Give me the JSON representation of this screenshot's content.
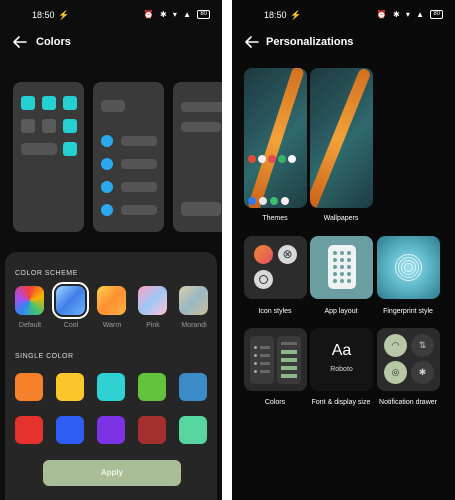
{
  "status": {
    "time": "18:50",
    "battery": "80"
  },
  "left": {
    "title": "Colors",
    "color_scheme_label": "COLOR SCHEME",
    "schemes": [
      {
        "name": "Default",
        "gradient": "conic-gradient(#f1413a,#f8b400,#43c76d,#2f86f6,#b24ae6,#f1413a)"
      },
      {
        "name": "Cool",
        "gradient": "linear-gradient(135deg,#9fd6ff,#3f7fe8,#6fb4ff)"
      },
      {
        "name": "Warm",
        "gradient": "linear-gradient(135deg,#ffd14f,#ff8f2f,#ffb347)"
      },
      {
        "name": "Pink",
        "gradient": "linear-gradient(135deg,#ff9fc0,#9fc7f5,#ffc3d5)"
      },
      {
        "name": "Morandi",
        "gradient": "linear-gradient(135deg,#d6d0a8,#9ab8c4,#c9bf96)"
      }
    ],
    "single_color_label": "SINGLE COLOR",
    "single_colors": [
      "#f5822b",
      "#fbc72a",
      "#2fd1d3",
      "#62c23c",
      "#3b8cc6",
      "#e5322f",
      "#2e5ff2",
      "#7c33e6",
      "#a3302d",
      "#57d6a0"
    ],
    "apply_label": "Apply"
  },
  "right": {
    "title": "Personalizations",
    "tiles": [
      {
        "label": "Themes"
      },
      {
        "label": "Wallpapers"
      },
      {
        "label": "Icon styles"
      },
      {
        "label": "App layout"
      },
      {
        "label": "Fingerprint style"
      },
      {
        "label": "Colors"
      },
      {
        "label": "Font & display size",
        "preview_big": "Aa",
        "preview_font": "Roboto"
      },
      {
        "label": "Notification drawer"
      }
    ]
  }
}
